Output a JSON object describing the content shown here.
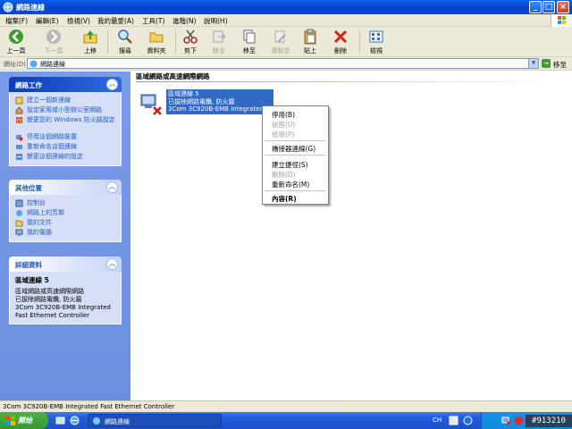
{
  "window": {
    "title": "網路連線",
    "controls": {
      "minimize": "_",
      "maximize": "□",
      "close": "×"
    }
  },
  "menubar": {
    "items": [
      "檔案(F)",
      "編輯(E)",
      "檢視(V)",
      "我的最愛(A)",
      "工具(T)",
      "進階(N)",
      "說明(H)"
    ]
  },
  "toolbar": {
    "back": "上一頁",
    "forward": "下一頁",
    "up": "上移",
    "search": "搜尋",
    "folders": "資料夾",
    "cut": "剪下",
    "move_to": "移至",
    "copy_to": "複製",
    "copy": "複製至",
    "paste": "貼上",
    "delete": "刪除",
    "views": "檢視"
  },
  "address": {
    "label": "網址(D)",
    "value": "網路連線",
    "go": "移至"
  },
  "left_pane": {
    "network_tasks": {
      "title": "網路工作",
      "items": [
        "建立一個新連線",
        "設定家用或小型辦公室網路",
        "變更您的 Windows 防火牆設定",
        "停用這個網路裝置",
        "重新命名這個連線",
        "變更這個連線的設定"
      ]
    },
    "other_places": {
      "title": "其他位置",
      "items": [
        "控制台",
        "網路上的芳鄰",
        "我的文件",
        "我的電腦"
      ]
    },
    "details": {
      "title": "詳細資料",
      "name": "區域連線 5",
      "type": "區域網路或高速網際網路",
      "status": "已拔除網路電纜, 防火牆",
      "device": "3Com 3C920B-EMB Integrated Fast Ethernet Controller"
    }
  },
  "content": {
    "group_title": "區域網路或高速網際網路",
    "connection": {
      "name": "區域連線 5",
      "status": "已拔除網路電纜, 防火牆",
      "device": "3Com 3C920B-EMB Integrated Fast Ethernet Controller"
    }
  },
  "context_menu": {
    "items": [
      {
        "label": "停用(B)",
        "enabled": true
      },
      {
        "label": "狀態(U)",
        "enabled": false
      },
      {
        "label": "修復(P)",
        "enabled": false
      },
      {
        "label": "橋接器連線(G)",
        "enabled": true
      },
      {
        "label": "建立捷徑(S)",
        "enabled": true
      },
      {
        "label": "刪除(D)",
        "enabled": false
      },
      {
        "label": "重新命名(M)",
        "enabled": true
      },
      {
        "label": "內容(R)",
        "enabled": true
      }
    ]
  },
  "statusbar": {
    "text": "3Com 3C920B-EMB Integrated Fast Ethernet Controller"
  },
  "taskbar": {
    "start": "開始",
    "task_item": "網路連線",
    "language": "CH"
  },
  "watermark": "#913210",
  "colors": {
    "title_blue": "#0a4fd8",
    "selection": "#316ac5",
    "left_pane": "#7294e4",
    "link": "#215dc6",
    "start_green": "#3c9b35"
  }
}
